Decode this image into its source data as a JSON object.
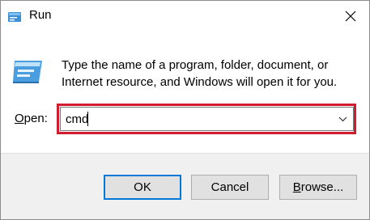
{
  "window": {
    "title": "Run",
    "title_icon": "run-icon",
    "close_icon": "close-icon"
  },
  "content": {
    "icon": "run-app-icon",
    "description_line1": "Type the name of a program, folder, document, or",
    "description_line2": "Internet resource, and Windows will open it for you."
  },
  "open_field": {
    "label_accel": "O",
    "label_rest": "pen:",
    "value": "cmd",
    "dropdown_icon": "chevron-down-icon",
    "highlight_color": "#d01c2e"
  },
  "buttons": {
    "ok": "OK",
    "cancel": "Cancel",
    "browse_accel": "B",
    "browse_rest": "rowse..."
  },
  "colors": {
    "default_button_border": "#0078d7",
    "footer_background": "#f0f0f0"
  }
}
